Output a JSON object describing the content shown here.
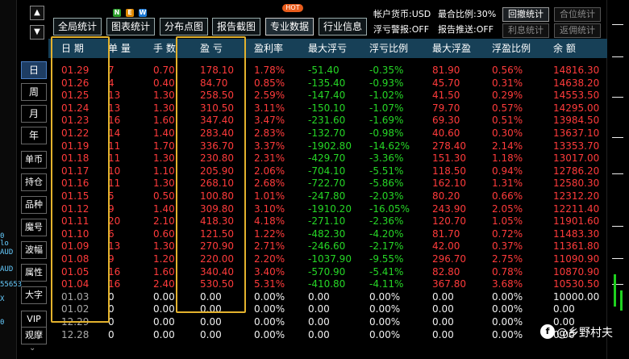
{
  "toolbar": {
    "buttons": [
      "全局统计",
      "图表统计",
      "分布点图",
      "报告截图",
      "专业数据",
      "行业信息"
    ],
    "new_badge": [
      "N",
      "E",
      "W"
    ],
    "hot_badge": "HOT"
  },
  "info": {
    "currency": "帐户货币:USD",
    "max_ratio": "最合比例:30%",
    "float_alert": "浮亏警报:OFF",
    "report_push": "报告推送:OFF"
  },
  "right_buttons": [
    "回撤统计",
    "合位统计",
    "利息统计",
    "返佣统计"
  ],
  "side_tabs": [
    "日",
    "周",
    "月",
    "年",
    "单币",
    "持仓",
    "品种",
    "魔号",
    "波幅",
    "属性",
    "大字",
    "VIP",
    "观摩"
  ],
  "left_marks": [
    "0",
    "lo",
    "AUD",
    "AUD",
    "55653",
    "X",
    "0"
  ],
  "columns": [
    "日 期",
    "单 量",
    "手 数",
    "盈 亏",
    "盈利率",
    "最大浮亏",
    "浮亏比例",
    "最大浮盈",
    "浮盈比例",
    "余 额"
  ],
  "rows": [
    [
      "01.29",
      "7",
      "0.70",
      "178.10",
      "1.78%",
      "-51.40",
      "-0.35%",
      "81.90",
      "0.56%",
      "14816.30",
      "red"
    ],
    [
      "01.26",
      "4",
      "0.40",
      "84.70",
      "0.85%",
      "-135.40",
      "-0.93%",
      "45.70",
      "0.31%",
      "14638.20",
      "red"
    ],
    [
      "01.25",
      "13",
      "1.30",
      "258.50",
      "2.59%",
      "-147.40",
      "-1.02%",
      "41.50",
      "0.29%",
      "14553.50",
      "red"
    ],
    [
      "01.24",
      "13",
      "1.30",
      "310.50",
      "3.11%",
      "-150.10",
      "-1.07%",
      "79.70",
      "0.57%",
      "14295.00",
      "red"
    ],
    [
      "01.23",
      "16",
      "1.60",
      "347.40",
      "3.47%",
      "-231.60",
      "-1.69%",
      "69.30",
      "0.51%",
      "13984.50",
      "red"
    ],
    [
      "01.22",
      "14",
      "1.40",
      "283.40",
      "2.83%",
      "-132.70",
      "-0.98%",
      "40.60",
      "0.30%",
      "13637.10",
      "red"
    ],
    [
      "01.19",
      "11",
      "1.70",
      "336.70",
      "3.37%",
      "-1902.80",
      "-14.62%",
      "278.40",
      "2.14%",
      "13353.70",
      "red"
    ],
    [
      "01.18",
      "11",
      "1.30",
      "230.80",
      "2.31%",
      "-429.70",
      "-3.36%",
      "151.30",
      "1.18%",
      "13017.00",
      "red"
    ],
    [
      "01.17",
      "10",
      "1.10",
      "205.90",
      "2.06%",
      "-704.10",
      "-5.51%",
      "118.50",
      "0.94%",
      "12786.20",
      "red"
    ],
    [
      "01.16",
      "11",
      "1.30",
      "268.10",
      "2.68%",
      "-722.70",
      "-5.86%",
      "162.10",
      "1.31%",
      "12580.30",
      "red"
    ],
    [
      "01.15",
      "5",
      "0.50",
      "100.80",
      "1.01%",
      "-247.80",
      "-2.03%",
      "80.20",
      "0.66%",
      "12312.20",
      "red"
    ],
    [
      "01.12",
      "9",
      "1.40",
      "309.80",
      "3.10%",
      "-1910.20",
      "-16.05%",
      "243.90",
      "2.05%",
      "12211.40",
      "red"
    ],
    [
      "01.11",
      "20",
      "2.10",
      "418.30",
      "4.18%",
      "-271.10",
      "-2.36%",
      "120.70",
      "1.05%",
      "11901.60",
      "red"
    ],
    [
      "01.10",
      "6",
      "0.60",
      "121.50",
      "1.22%",
      "-482.30",
      "-4.20%",
      "81.70",
      "0.72%",
      "11483.30",
      "red"
    ],
    [
      "01.09",
      "13",
      "1.30",
      "270.90",
      "2.71%",
      "-246.60",
      "-2.17%",
      "42.00",
      "0.37%",
      "11361.80",
      "red"
    ],
    [
      "01.08",
      "9",
      "1.20",
      "220.00",
      "2.20%",
      "-1037.90",
      "-9.55%",
      "296.70",
      "2.75%",
      "11090.90",
      "red"
    ],
    [
      "01.05",
      "16",
      "1.60",
      "340.40",
      "3.40%",
      "-570.90",
      "-5.41%",
      "82.80",
      "0.78%",
      "10870.90",
      "red"
    ],
    [
      "01.04",
      "16",
      "2.40",
      "530.50",
      "5.31%",
      "-410.80",
      "-4.11%",
      "367.80",
      "3.68%",
      "10530.50",
      "red"
    ],
    [
      "01.03",
      "0",
      "0.00",
      "0.00",
      "0.00%",
      "0.00",
      "0.00%",
      "0.00",
      "0.00%",
      "10000.00",
      "white"
    ],
    [
      "01.02",
      "0",
      "0.00",
      "0.00",
      "0.00%",
      "0.00",
      "0.00%",
      "0.00",
      "0.00%",
      "0.00",
      "white"
    ],
    [
      "12.29",
      "0",
      "0.00",
      "0.00",
      "0.00%",
      "0.00",
      "0.00%",
      "0.00",
      "0.00%",
      "0.00",
      "white"
    ],
    [
      "12.28",
      "0",
      "0.00",
      "0.00",
      "0.00%",
      "0.00",
      "0.00%",
      "0.00",
      "0.00%",
      "0.00",
      "white"
    ]
  ],
  "watermark": "@乡野村夫"
}
